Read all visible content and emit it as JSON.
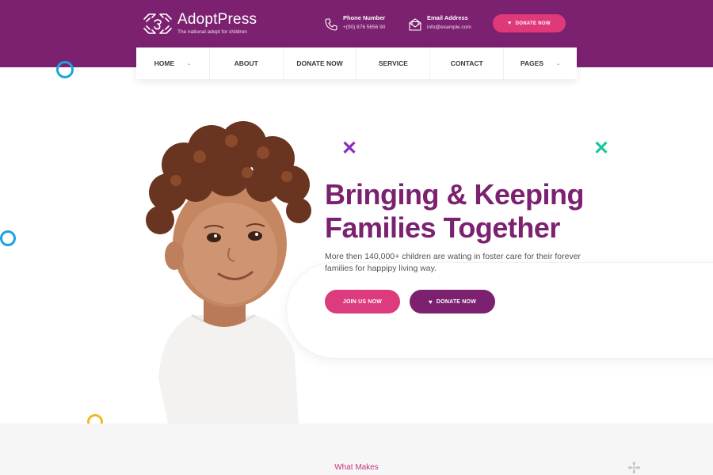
{
  "brand": {
    "name": "AdoptPress",
    "tagline": "The national adopt for children",
    "logo_icon": "hands-heart-logo-icon",
    "primary_color": "#7b2170",
    "accent_color": "#e0397a"
  },
  "header": {
    "phone": {
      "label": "Phone Number",
      "value": "+(90) 876 5656 90",
      "icon": "phone-icon"
    },
    "email": {
      "label": "Email Address",
      "value": "info@example.com",
      "icon": "envelope-icon"
    },
    "donate_label": "DONATE NOW"
  },
  "nav": {
    "items": [
      {
        "label": "HOME",
        "has_dropdown": true
      },
      {
        "label": "ABOUT",
        "has_dropdown": false
      },
      {
        "label": "DONATE NOW",
        "has_dropdown": false
      },
      {
        "label": "SERVICE",
        "has_dropdown": false
      },
      {
        "label": "CONTACT",
        "has_dropdown": false
      },
      {
        "label": "PAGES",
        "has_dropdown": true
      }
    ]
  },
  "hero": {
    "title_line1": "Bringing & Keeping",
    "title_line2": "Families Together",
    "description": "More then 140,000+ children are wating in foster care for their forever families for happipy living way.",
    "join_label": "JOIN US NOW",
    "donate_label": "DONATE NOW"
  },
  "lower": {
    "tag": "What Makes"
  }
}
